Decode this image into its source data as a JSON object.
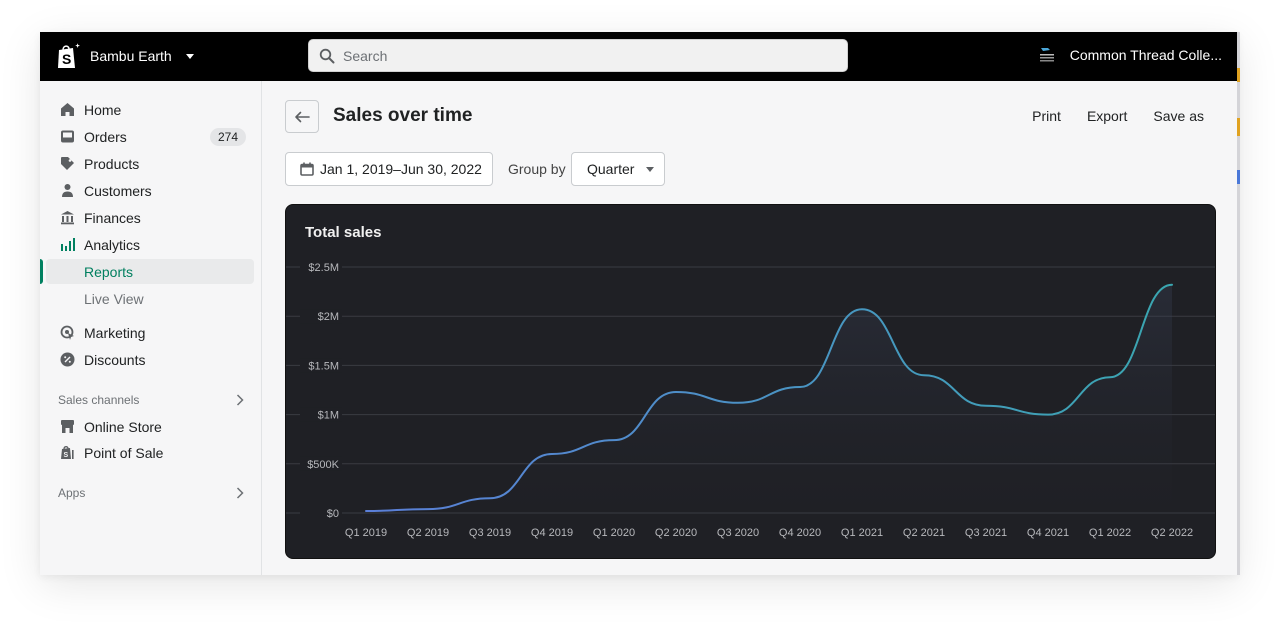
{
  "topbar": {
    "store_name": "Bambu Earth",
    "search_placeholder": "Search",
    "account_name": "Common Thread Colle..."
  },
  "sidebar": {
    "items": [
      {
        "label": "Home",
        "icon": "home-icon"
      },
      {
        "label": "Orders",
        "icon": "inbox-icon",
        "badge": "274"
      },
      {
        "label": "Products",
        "icon": "tag-icon"
      },
      {
        "label": "Customers",
        "icon": "person-icon"
      },
      {
        "label": "Finances",
        "icon": "bank-icon"
      },
      {
        "label": "Analytics",
        "icon": "bar-chart-icon"
      }
    ],
    "analytics_sub": [
      {
        "label": "Reports",
        "active": true
      },
      {
        "label": "Live View",
        "active": false
      }
    ],
    "items2": [
      {
        "label": "Marketing",
        "icon": "target-icon"
      },
      {
        "label": "Discounts",
        "icon": "discount-icon"
      }
    ],
    "sales_channels_title": "Sales channels",
    "channels": [
      {
        "label": "Online Store",
        "icon": "storefront-icon"
      },
      {
        "label": "Point of Sale",
        "icon": "pos-bag-icon"
      }
    ],
    "apps_title": "Apps",
    "accent_color": "#008060"
  },
  "header": {
    "title": "Sales over time",
    "actions": {
      "print": "Print",
      "export": "Export",
      "save_as": "Save as"
    }
  },
  "filters": {
    "date_range": "Jan 1, 2019–Jun 30, 2022",
    "group_by_label": "Group by",
    "group_by_value": "Quarter"
  },
  "chart_data": {
    "type": "line",
    "title": "Total sales",
    "xlabel": "",
    "ylabel": "",
    "categories": [
      "Q1 2019",
      "Q2 2019",
      "Q3 2019",
      "Q4 2019",
      "Q1 2020",
      "Q2 2020",
      "Q3 2020",
      "Q4 2020",
      "Q1 2021",
      "Q2 2021",
      "Q3 2021",
      "Q4 2021",
      "Q1 2022",
      "Q2 2022"
    ],
    "series": [
      {
        "name": "Total sales",
        "values": [
          20000,
          40000,
          150000,
          600000,
          740000,
          1230000,
          1120000,
          1280000,
          2070000,
          1400000,
          1090000,
          1000000,
          1380000,
          2320000
        ]
      }
    ],
    "ylim": [
      0,
      2500000
    ],
    "yticks": [
      0,
      500000,
      1000000,
      1500000,
      2000000,
      2500000
    ],
    "ytick_labels": [
      "$0",
      "$500K",
      "$1M",
      "$1.5M",
      "$2M",
      "$2.5M"
    ],
    "grid": true,
    "legend": "none",
    "line_colors": [
      "#5b7fd8",
      "#3aa6b0"
    ]
  }
}
